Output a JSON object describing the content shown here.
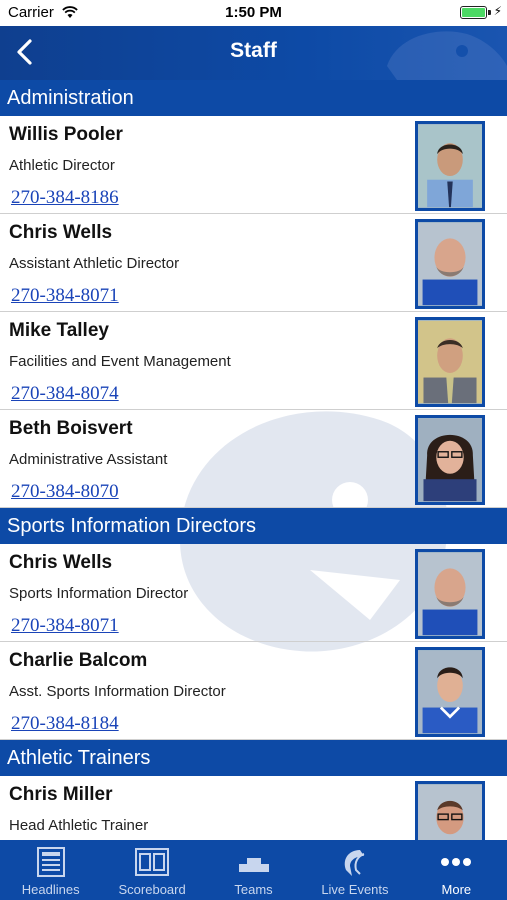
{
  "status_bar": {
    "carrier": "Carrier",
    "time": "1:50 PM"
  },
  "nav": {
    "title": "Staff"
  },
  "sections": [
    {
      "title": "Administration",
      "people": [
        {
          "name": "Willis Pooler",
          "role": "Athletic Director",
          "phone": "270-384-8186"
        },
        {
          "name": "Chris Wells",
          "role": "Assistant Athletic Director",
          "phone": "270-384-8071"
        },
        {
          "name": "Mike Talley",
          "role": "Facilities and Event Management",
          "phone": "270-384-8074"
        },
        {
          "name": "Beth Boisvert",
          "role": "Administrative Assistant",
          "phone": "270-384-8070"
        }
      ]
    },
    {
      "title": "Sports Information Directors",
      "people": [
        {
          "name": "Chris Wells",
          "role": "Sports Information Director",
          "phone": "270-384-8071"
        },
        {
          "name": "Charlie Balcom",
          "role": "Asst. Sports Information Director",
          "phone": "270-384-8184"
        }
      ]
    },
    {
      "title": "Athletic Trainers",
      "people": [
        {
          "name": "Chris Miller",
          "role": "Head Athletic Trainer",
          "phone": ""
        }
      ]
    }
  ],
  "tabs": [
    {
      "label": "Headlines",
      "icon": "headlines-icon"
    },
    {
      "label": "Scoreboard",
      "icon": "scoreboard-icon"
    },
    {
      "label": "Teams",
      "icon": "teams-icon"
    },
    {
      "label": "Live Events",
      "icon": "live-events-icon"
    },
    {
      "label": "More",
      "icon": "more-icon"
    }
  ],
  "colors": {
    "brand_blue": "#0d4aa6",
    "link_blue": "#1a44b8",
    "battery_green": "#4cd964"
  }
}
